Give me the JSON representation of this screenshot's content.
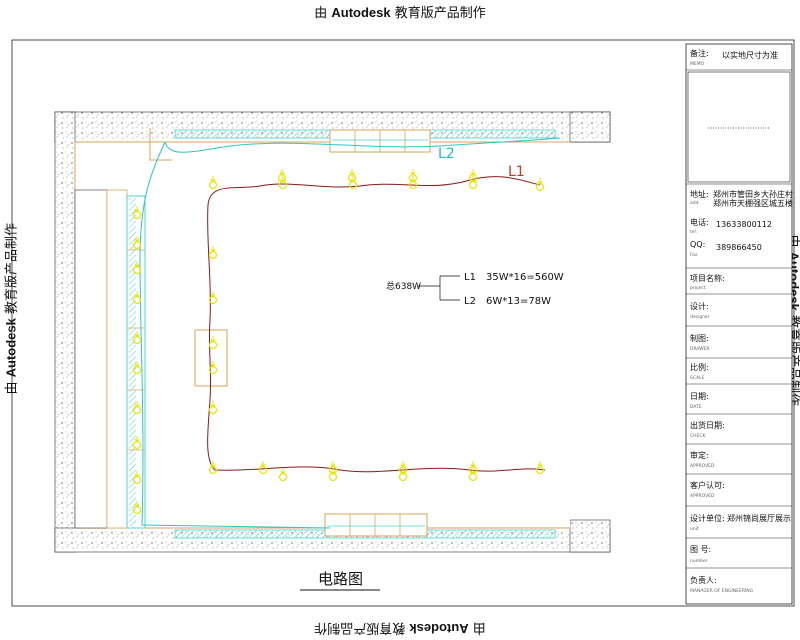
{
  "watermark": {
    "prefix": "由 ",
    "brand": "Autodesk",
    "suffix": " 教育版产品制作"
  },
  "drawing": {
    "title": "电路图",
    "total_label": "总638W",
    "circuits": [
      {
        "id": "L1",
        "spec": "35W*16=560W",
        "color": "#c0392b"
      },
      {
        "id": "L2",
        "spec": "6W*13=78W",
        "color": "#1fbfbf"
      }
    ],
    "colors": {
      "wall": "#f6d9a8",
      "cabinet": "#4fd2d2",
      "fixture": "#e6e600",
      "wire_l1": "#8b1a1a",
      "wire_l2": "#2ec4c4"
    }
  },
  "title_block": {
    "memo": {
      "label": "备注:",
      "sub": "MEMO",
      "value": "以实地尺寸为准"
    },
    "address": {
      "label": "地址:",
      "sub": "add.",
      "line1": "郑州市管田乡大孙庄村",
      "line2": "郑州市天棚强区城五楼"
    },
    "tel": {
      "label": "电话:",
      "sub": "tel.",
      "value": "13633800112"
    },
    "qq": {
      "label": "QQ:",
      "sub": "Fax",
      "value": "389866450"
    },
    "rows": [
      {
        "label": "项目名称:",
        "sub": "project"
      },
      {
        "label": "设计:",
        "sub": "designer"
      },
      {
        "label": "制图:",
        "sub": "DRAWER"
      },
      {
        "label": "比例:",
        "sub": "SCALE"
      },
      {
        "label": "日期:",
        "sub": "DATE"
      },
      {
        "label": "出货日期:",
        "sub": "CHECK"
      },
      {
        "label": "审定:",
        "sub": "APPROVED"
      },
      {
        "label": "客户认可:",
        "sub": "APPROVED"
      }
    ],
    "design_unit": {
      "label": "设计单位:",
      "sub": "unit",
      "value": "郑州锦尚展厅展示"
    },
    "drawing_no": {
      "label": "图  号:",
      "sub": "number"
    },
    "manager": {
      "label": "负责人:",
      "sub": "MANAGER OF ENGINEERING"
    }
  }
}
